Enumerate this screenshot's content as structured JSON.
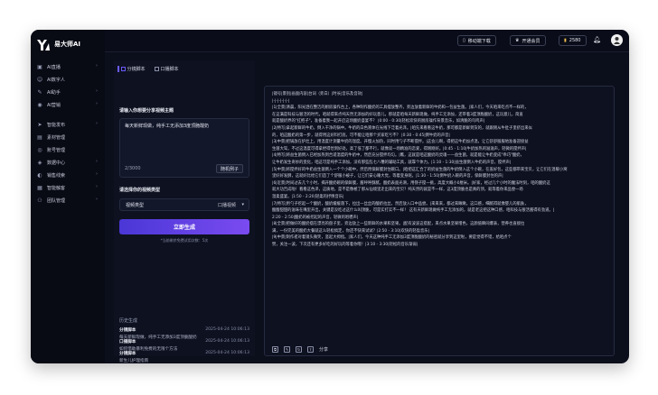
{
  "app": {
    "name": "易大师AI"
  },
  "sidebar": {
    "items": [
      {
        "icon": "live-icon",
        "label": "AI直播",
        "chevron": true
      },
      {
        "icon": "digital-human-icon",
        "label": "AI数字人",
        "chevron": false
      },
      {
        "icon": "ai-writing-icon",
        "label": "AI助手",
        "chevron": true
      },
      {
        "icon": "ai-marketing-icon",
        "label": "AI营销",
        "chevron": true
      },
      {
        "icon": "smart-publish-icon",
        "label": "智能发布",
        "chevron": true
      },
      {
        "icon": "material-icon",
        "label": "素材管理",
        "chevron": false
      },
      {
        "icon": "account-icon",
        "label": "账号管理",
        "chevron": false
      },
      {
        "icon": "data-center-icon",
        "label": "数据中心",
        "chevron": true
      },
      {
        "icon": "sales-lead-icon",
        "label": "销售线索",
        "chevron": true
      },
      {
        "icon": "smart-screen-icon",
        "label": "智能触客",
        "chevron": true
      },
      {
        "icon": "team-icon",
        "label": "团队管理",
        "chevron": true
      }
    ]
  },
  "topbar": {
    "download_label": "移动端下载",
    "vip_label": "开通会员",
    "coins": "2580"
  },
  "left_panel": {
    "tab_active": "分镜脚本",
    "tab_inactive": "口播脚本",
    "topic_label": "请输入你想要分享视频主题",
    "topic_value": "每天新鲜现做，纯手工无添加3度顶脆酸奶",
    "counter": "2/3000",
    "random_button": "随机例子",
    "type_label": "请选择你的视频类型",
    "type_value": "视频类型",
    "type_right": "口播视频",
    "generate_button": "立即生成",
    "note": "*当前剩余免费试用次数：5次",
    "history_title": "历史生成",
    "history": [
      {
        "title": "分镜脚本",
        "date": "2025-04-24 10:06:13",
        "sub": "每天新鲜现做，纯手工无添加3度顶脆酸奶"
      },
      {
        "title": "口播脚本",
        "date": "2025-04-24 10:06:13",
        "sub": "如何借助暴利免费的无限个方法"
      },
      {
        "title": "分镜脚本",
        "date": "2025-04-24 10:06:13",
        "sub": "新生儿护理指南"
      }
    ]
  },
  "right_panel": {
    "lines": [
      "|镜号|景别|画面内容|台词（旁白）|时长|音乐及音效|",
      "|-|-|-|-|-|-|",
      "|1|全景|清晨，阳光洒在整洁的厨房操作台上，各种制作酸奶的工具摆放整齐，旁边放着新鲜的牛奶和一包益生菌。|家人们，今天咱来吃点不一样的，",
      "在这满是科技与狠活的时代，咱就得来点纯天然无添加的好玩意儿，那就是咱每天新鲜现做，纯手工无添加，还带着3度顶脆酸奶，这玩意儿，简直",
      "就是酸奶界的\"扛把子\"，准备着我一起开启这场酸奶盛宴不？ |0:00 - 0:30|轻松欢快的厨房操作背景音乐，如清脆的鸟鸣声|",
      "|2|特写|拿起新鲜的牛奶，倒入干净的锅中。牛奶的白色液体在光线下泛着光泽。|咱先来看看这牛奶，那可都是新鲜到货的，就跟刚从牛肚子里挤出来似",
      "的，咱这酸奶的第一步，就得用这好料打底，可不能让咱那个买家吃亏不？ |0:30 - 0:45|倒牛奶的声音|",
      "|3|中景|把锅放在炉灶上，用温度计测量牛奶的温度。开慢火加热，同时用勺子不断搅拌。|这会儿啊，得把这牛奶加点温，让它舒舒服服地准备迎接益",
      "生菌大驾，不过这温度可得拿捏得恰到好处，高了低了都不行，就像谈一场精准的恋爱，得刚刚好。|0:45 - 1:10|牛奶加热的滋滋声，轻微的搅拌声|",
      "|4|特写|将益生菌倒入已经加热到合适温度的牛奶中，然后充分搅拌均匀。|瞧，这就是咱这酸奶的灵魂——益生菌，就是能让牛奶变成\"乖巧\"酸奶，",
      "让牛奶发生奇妙的变化，咱这可是纯手工添加，没有那些乱七八糟的辅助工具，就靠个体力。|1:10 - 1:30|益生菌倒入牛奶的声音，搅拌声|",
      "|5|中景|将搅拌好的牛奶益生菌倒入一个个小碗中，然后用保鲜膜封住碗口。|咱把这汇合了的奶益生菌的牛奶倒入这个小碗，在盖好包，这些都带来宝贝，让它们在温暖小窝",
      "里好好发酵，这就好比给它们造了个舒服小被子，让它们安心睡大觉，等着变身呢。|1:30 - 1:50|倒牛奶入碗的声音，保鲜膜封住的声|",
      "|6|近景|时间过去几个小时，揭开酸奶碗的保鲜膜，酱呼呼酥腻，酸奶表面光滑，用筷子搅一挑，高度大概小0厘米。|好家，经过几个小时的魔法时刻，咱的酸奶这",
      "就大功告成啦！看看这色泽，这质地，是不是像極了那从仙境里走出来的宝贝？纯天然的就是不一样，这3度顶脆也是真的顶，就等着你来品尝一场",
      "温柔盛宴。|1:50 - 2:20|轻柔的抒情音乐|",
      "|7|特写|用勺子挖起一个酸奶，酸奶缓缓落下，拉出一丝丝的酸奶拉丝，然后放入口中品尝。|来来来，都过来瞅瞅，这口感，细腻得就像婴儿的肌肤，",
      "酸酸甜甜的滋味在嘴里开出，关键是没吃过这什么叫顶脆，可是实打实不一样！ 这有天新鲜现做纯手工无添加的，就是老这把这种口感，咱科技与狠活酱得有劲道。|",
      "2:20 - 2:50|酸奶的被挖起的声音，轻微的咀嚼声|",
      "|8|全景|把做好的酸奶摆在漂亮的盘子里，旁边放上一些新鲜的水果和坚果。|配有波波这搭配，来点水果坚果增色，这颜值瞬间爆表，营养也直接拉",
      "满，一份完美的酸奶大餐就这么轻松搞定，你还不快来试试？|2:50 - 3:10|欢快的轻盈音乐|",
      "|9|中景|制作者对着镜头微笑，竖起大拇指。|家人们，今天这种纯手工无添加3度顶脆酸奶的秘密就分享到这里啦，要是觉得不错，给咱点个",
      "赞，关注一波，下次还有更多好吃的好玩的等着你哦！|3:10 - 3:30|轻松的音乐渐弱|"
    ],
    "share_label": "分享"
  }
}
